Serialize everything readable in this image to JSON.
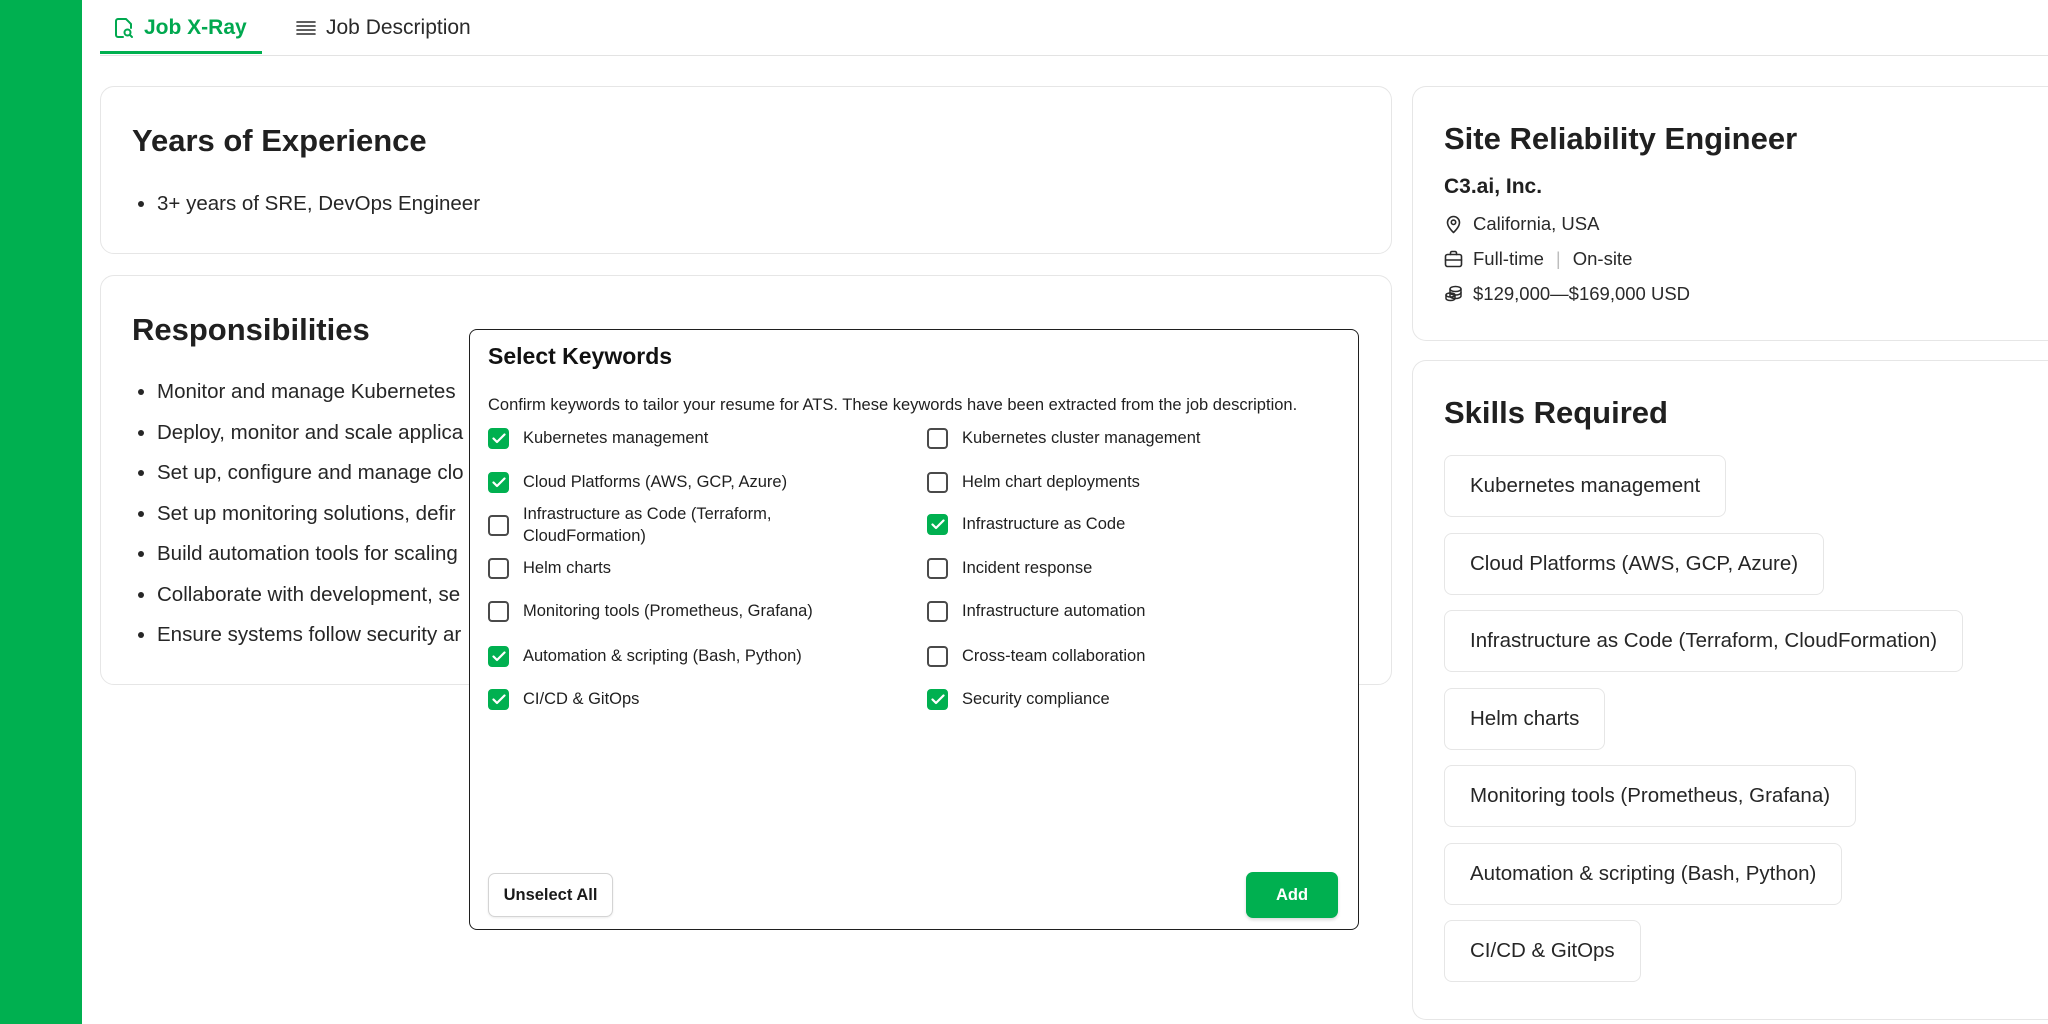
{
  "tabs": [
    {
      "label": "Job X-Ray",
      "icon": "document-search-icon",
      "active": true
    },
    {
      "label": "Job Description",
      "icon": "list-lines-icon",
      "active": false
    }
  ],
  "experience": {
    "title": "Years of Experience",
    "items": [
      "3+ years of SRE, DevOps Engineer"
    ]
  },
  "responsibilities": {
    "title": "Responsibilities",
    "items": [
      "Monitor and manage Kubernetes",
      "Deploy, monitor and scale applica",
      "Set up, configure and manage clo",
      "Set up monitoring solutions, defir",
      "Build automation tools for scaling",
      "Collaborate with development, se",
      "Ensure systems follow security ar"
    ]
  },
  "job": {
    "title": "Site Reliability Engineer",
    "company": "C3.ai, Inc.",
    "location": "California, USA",
    "employment_type": "Full-time",
    "separator": "|",
    "work_mode": "On-site",
    "salary": "$129,000—$169,000 USD"
  },
  "skills": {
    "title": "Skills Required",
    "items": [
      "Kubernetes management",
      "Cloud Platforms (AWS, GCP, Azure)",
      "Infrastructure as Code (Terraform, CloudFormation)",
      "Helm charts",
      "Monitoring tools (Prometheus, Grafana)",
      "Automation & scripting (Bash, Python)",
      "CI/CD & GitOps"
    ]
  },
  "modal": {
    "title": "Select Keywords",
    "description": "Confirm keywords to tailor your resume for ATS. These keywords have been extracted from the job description.",
    "keywords": [
      {
        "label": "Kubernetes management",
        "checked": true
      },
      {
        "label": "Kubernetes cluster management",
        "checked": false
      },
      {
        "label": "Cloud Platforms (AWS, GCP, Azure)",
        "checked": true
      },
      {
        "label": "Helm chart deployments",
        "checked": false
      },
      {
        "label": "Infrastructure as Code (Terraform, CloudFormation)",
        "checked": false
      },
      {
        "label": "Infrastructure as Code",
        "checked": true
      },
      {
        "label": "Helm charts",
        "checked": false
      },
      {
        "label": "Incident response",
        "checked": false
      },
      {
        "label": "Monitoring tools (Prometheus, Grafana)",
        "checked": false
      },
      {
        "label": "Infrastructure automation",
        "checked": false
      },
      {
        "label": "Automation & scripting (Bash, Python)",
        "checked": true
      },
      {
        "label": "Cross-team collaboration",
        "checked": false
      },
      {
        "label": "CI/CD & GitOps",
        "checked": true
      },
      {
        "label": "Security compliance",
        "checked": true
      }
    ],
    "unselect_label": "Unselect All",
    "add_label": "Add"
  },
  "colors": {
    "accent": "#00b050",
    "border": "#e6e6e6",
    "text": "#1f1f1f"
  }
}
